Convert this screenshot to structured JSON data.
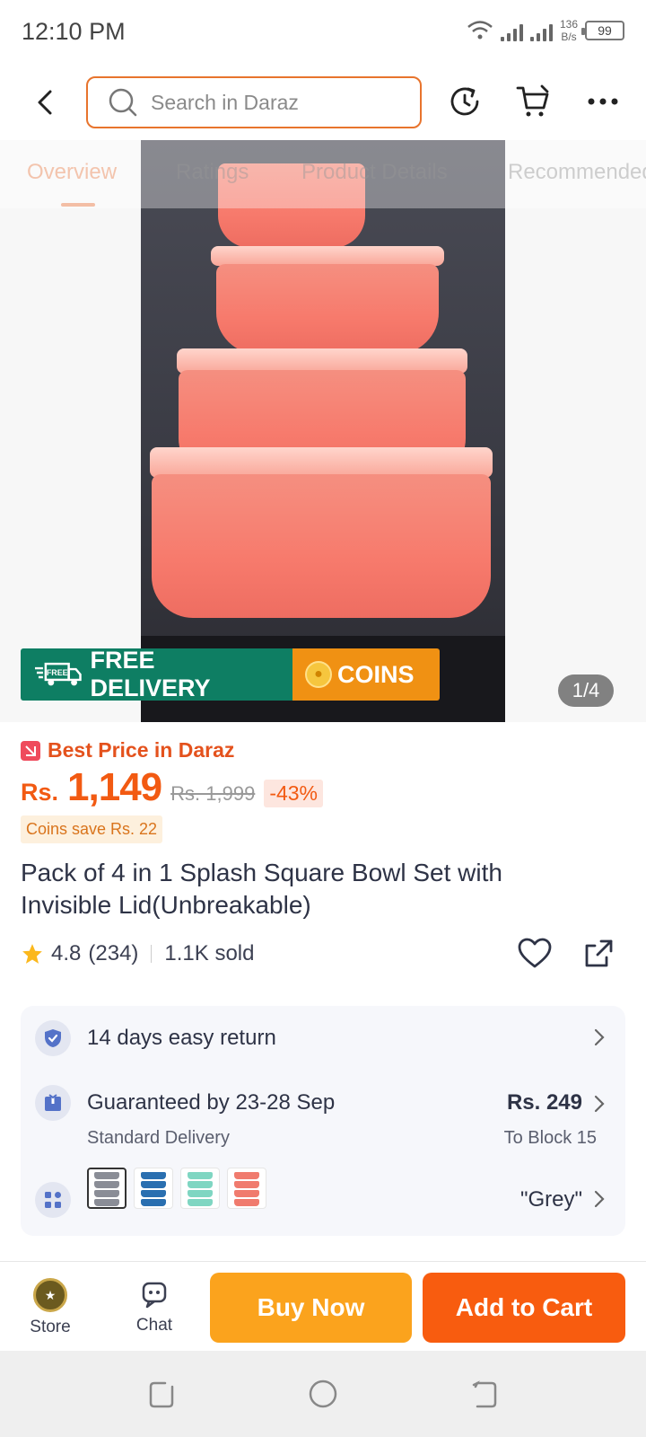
{
  "status_bar": {
    "time": "12:10 PM",
    "net_speed_value": "136",
    "net_speed_unit": "B/s",
    "battery": "99"
  },
  "header": {
    "search_placeholder": "Search in Daraz"
  },
  "tabs": [
    {
      "label": "Overview"
    },
    {
      "label": "Ratings"
    },
    {
      "label": "Product Details"
    },
    {
      "label": "Recommended"
    }
  ],
  "gallery": {
    "promo_delivery": "FREE DELIVERY",
    "promo_free_tag": "FREE",
    "promo_coins": "COINS",
    "counter": "1/4"
  },
  "pricing": {
    "badge": "Best Price in Daraz",
    "currency": "Rs.",
    "price": "1,149",
    "old_price": "Rs. 1,999",
    "discount": "-43%",
    "coins_save": "Coins save Rs. 22"
  },
  "product": {
    "title": "Pack of 4 in 1 Splash Square Bowl Set with Invisible Lid(Unbreakable)",
    "rating": "4.8",
    "reviews": "(234)",
    "sold": "1.1K sold"
  },
  "info": {
    "return_text": "14 days easy return",
    "delivery_text": "Guaranteed by 23-28 Sep",
    "delivery_sub": "Standard Delivery",
    "delivery_fee": "Rs. 249",
    "delivery_location": "To Block 15",
    "variant_value": "\"Grey\""
  },
  "variants": [
    {
      "color": "#8a8d96"
    },
    {
      "color": "#2a6fb0"
    },
    {
      "color": "#7fd6c2"
    },
    {
      "color": "#f07b6e"
    }
  ],
  "bottom_bar": {
    "store_label": "Store",
    "chat_label": "Chat",
    "buy_now": "Buy Now",
    "add_to_cart": "Add to Cart"
  },
  "colors": {
    "accent": "#f85c0f",
    "buy_now": "#fba31d",
    "delivery_green": "#0e7e63",
    "coins_orange": "#f09113"
  }
}
